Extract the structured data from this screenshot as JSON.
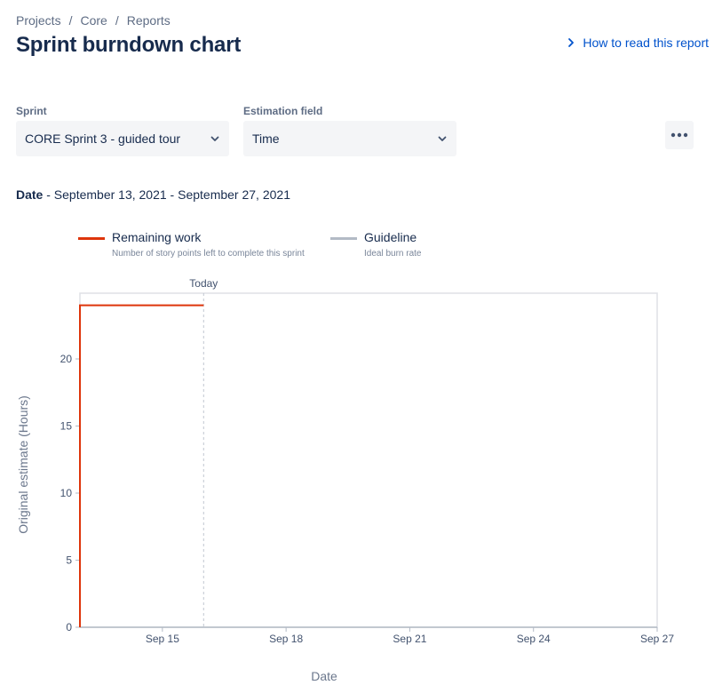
{
  "breadcrumb": {
    "items": [
      "Projects",
      "Core",
      "Reports"
    ],
    "separator": "/"
  },
  "page": {
    "title": "Sprint burndown chart",
    "help_link": "How to read this report"
  },
  "filters": {
    "sprint_label": "Sprint",
    "sprint_value": "CORE Sprint 3 - guided tour",
    "estimation_label": "Estimation field",
    "estimation_value": "Time",
    "more_icon": "more-horizontal-icon"
  },
  "date_range": {
    "label": "Date",
    "text": "- September 13, 2021 - September 27, 2021"
  },
  "legend": [
    {
      "title": "Remaining work",
      "subtitle": "Number of story points left to complete this sprint",
      "color": "#DE350B"
    },
    {
      "title": "Guideline",
      "subtitle": "Ideal burn rate",
      "color": "#B3BAC5"
    }
  ],
  "chart_data": {
    "type": "line",
    "xlabel": "Date",
    "ylabel": "Original estimate (Hours)",
    "x_start": "2021-09-13",
    "x_end": "2021-09-27",
    "x_ticks": [
      "Sep 15",
      "Sep 18",
      "Sep 21",
      "Sep 24",
      "Sep 27"
    ],
    "ylim": [
      0,
      24.9
    ],
    "yticks": [
      0,
      5,
      10,
      15,
      20
    ],
    "today_label": "Today",
    "today": "2021-09-16",
    "series": [
      {
        "name": "Remaining work",
        "color": "#DE350B",
        "points": [
          [
            "2021-09-13",
            0
          ],
          [
            "2021-09-13",
            24
          ],
          [
            "2021-09-16",
            24
          ]
        ]
      }
    ]
  }
}
